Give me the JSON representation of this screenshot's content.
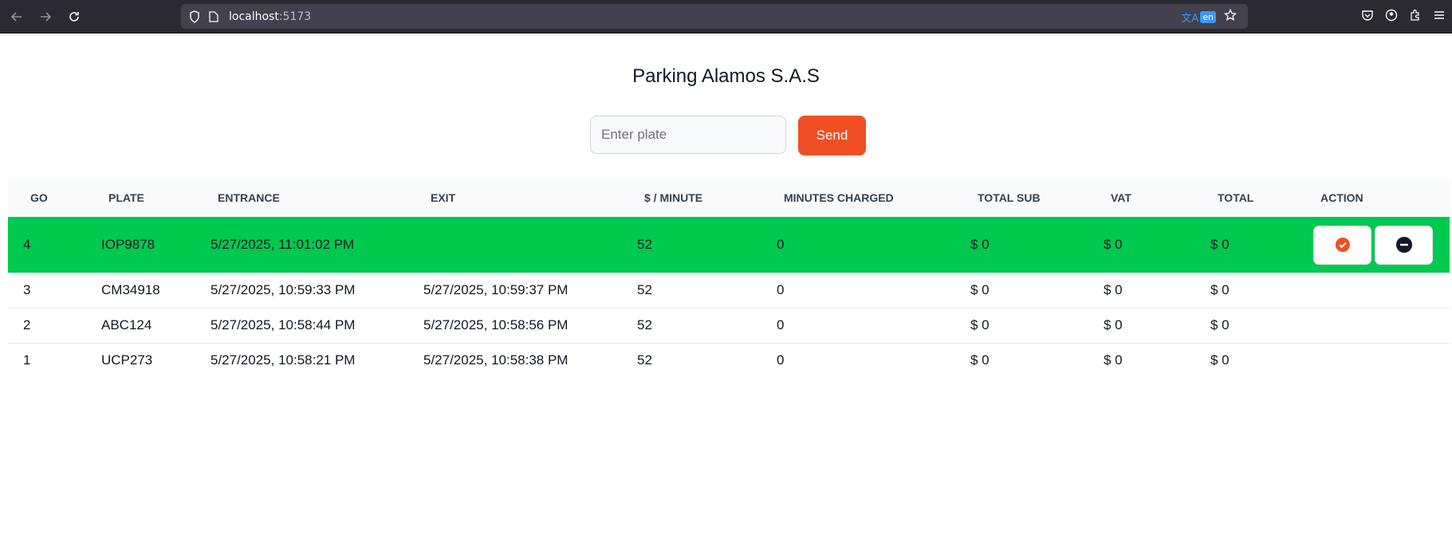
{
  "browser": {
    "url_host": "localhost",
    "url_port": ":5173",
    "translate_lang": "en"
  },
  "page": {
    "title": "Parking Alamos S.A.S"
  },
  "form": {
    "plate_placeholder": "Enter plate",
    "send_label": "Send"
  },
  "table": {
    "headers": [
      "GO",
      "PLATE",
      "ENTRANCE",
      "EXIT",
      "$ / MINUTE",
      "MINUTES CHARGED",
      "TOTAL SUB",
      "VAT",
      "TOTAL",
      "ACTION"
    ],
    "rows": [
      {
        "go": "4",
        "plate": "IOP9878",
        "entrance": "5/27/2025, 11:01:02 PM",
        "exit": "",
        "rate": "52",
        "minutes": "0",
        "total_sub": "$ 0",
        "vat": "$ 0",
        "total": "$ 0"
      },
      {
        "go": "3",
        "plate": "CM34918",
        "entrance": "5/27/2025, 10:59:33 PM",
        "exit": "5/27/2025, 10:59:37 PM",
        "rate": "52",
        "minutes": "0",
        "total_sub": "$ 0",
        "vat": "$ 0",
        "total": "$ 0"
      },
      {
        "go": "2",
        "plate": "ABC124",
        "entrance": "5/27/2025, 10:58:44 PM",
        "exit": "5/27/2025, 10:58:56 PM",
        "rate": "52",
        "minutes": "0",
        "total_sub": "$ 0",
        "vat": "$ 0",
        "total": "$ 0"
      },
      {
        "go": "1",
        "plate": "UCP273",
        "entrance": "5/27/2025, 10:58:21 PM",
        "exit": "5/27/2025, 10:58:38 PM",
        "rate": "52",
        "minutes": "0",
        "total_sub": "$ 0",
        "vat": "$ 0",
        "total": "$ 0"
      }
    ]
  },
  "colors": {
    "accent": "#ef4f23",
    "active_row": "#00c950"
  },
  "icons": {
    "confirm": "check-circle-icon",
    "remove": "minus-circle-icon"
  }
}
